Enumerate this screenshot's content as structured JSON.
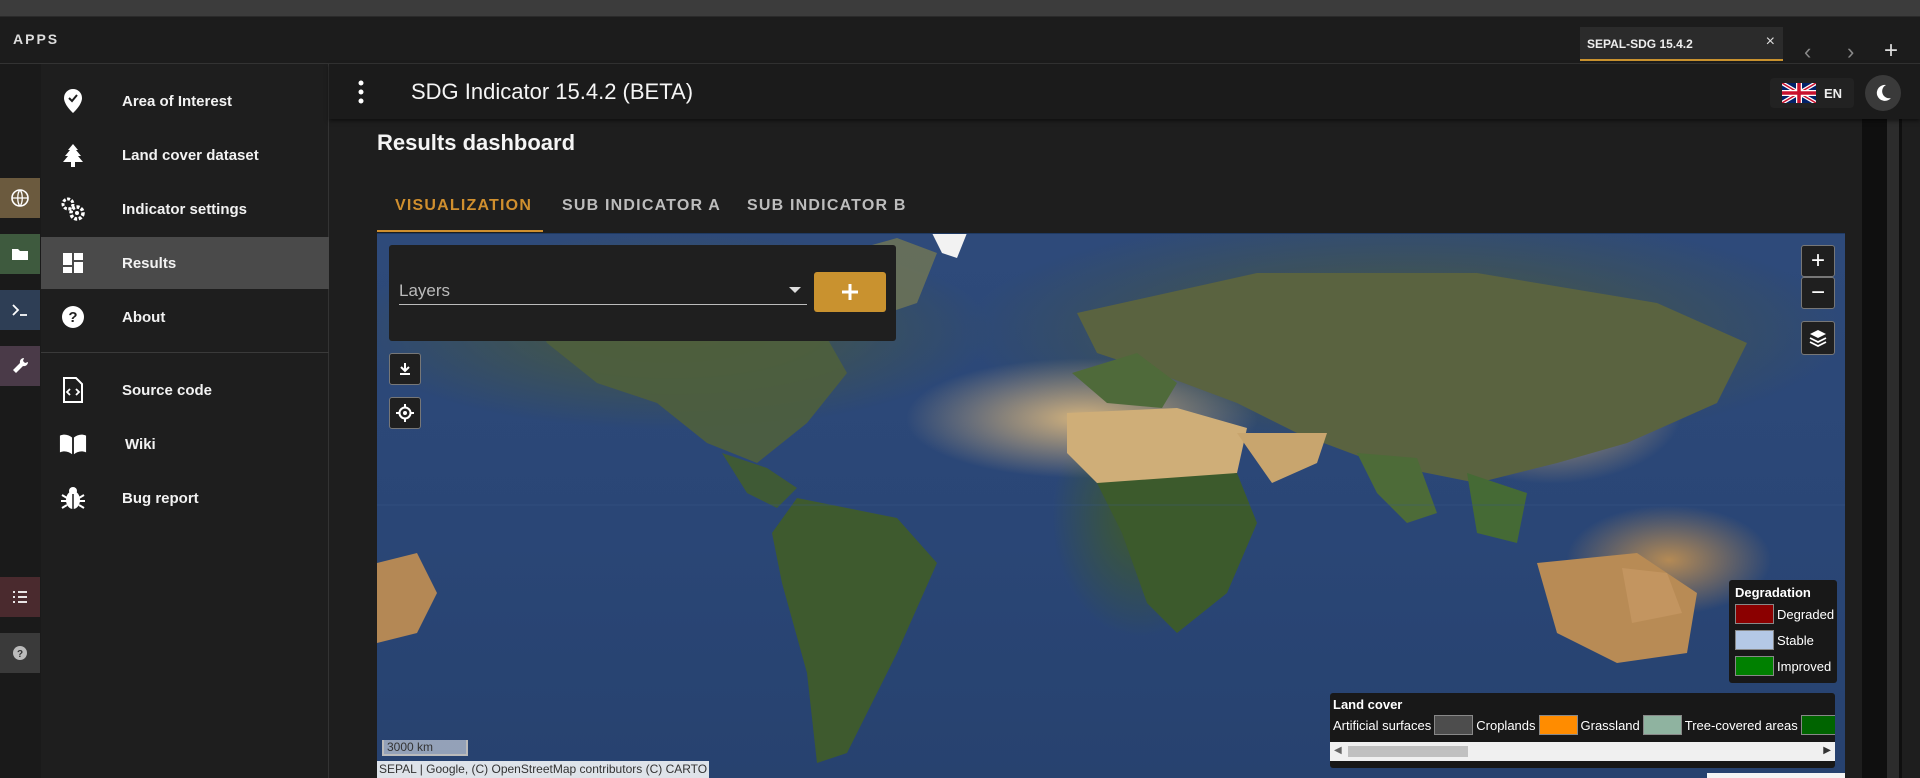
{
  "apps_bar": {
    "label": "APPS"
  },
  "browser_tab": {
    "label": "SEPAL-SDG 15.4.2",
    "close": "×",
    "prev": "‹",
    "next": "›",
    "add": "+"
  },
  "app_bar": {
    "title": "SDG Indicator 15.4.2 (BETA)",
    "language": "EN"
  },
  "drawer": {
    "items": [
      {
        "label": "Area of Interest",
        "icon": "map-marker-check-icon"
      },
      {
        "label": "Land cover dataset",
        "icon": "tree-icon"
      },
      {
        "label": "Indicator settings",
        "icon": "cogs-icon"
      },
      {
        "label": "Results",
        "icon": "dashboard-icon",
        "active": true
      },
      {
        "label": "About",
        "icon": "help-circle-icon"
      },
      {
        "label": "Source code",
        "icon": "file-code-icon"
      },
      {
        "label": "Wiki",
        "icon": "book-open-icon"
      },
      {
        "label": "Bug report",
        "icon": "bug-icon"
      }
    ]
  },
  "content": {
    "title": "Results dashboard",
    "tabs": [
      {
        "label": "VISUALIZATION",
        "active": true
      },
      {
        "label": "SUB INDICATOR A"
      },
      {
        "label": "SUB INDICATOR B"
      }
    ]
  },
  "map": {
    "layers_placeholder": "Layers",
    "add_label": "+",
    "zoom_in": "+",
    "zoom_out": "−",
    "scale": "3000 km",
    "attribution": "SEPAL | Google, (C) OpenStreetMap contributors (C) CARTO",
    "legend_degradation": {
      "title": "Degradation",
      "items": [
        {
          "label": "Degraded",
          "color": "#8b0000"
        },
        {
          "label": "Stable",
          "color": "#b4c8e6"
        },
        {
          "label": "Improved",
          "color": "#008000"
        }
      ]
    },
    "legend_land_cover": {
      "title": "Land cover",
      "items": [
        {
          "label": "Artificial surfaces",
          "color": "#4d4d4d"
        },
        {
          "label": "Croplands",
          "color": "#ff8c00"
        },
        {
          "label": "Grassland",
          "color": "#8fb3a0"
        },
        {
          "label": "Tree-covered areas",
          "color": "#006400"
        }
      ]
    }
  },
  "colors": {
    "accent": "#c9922f",
    "tab_active": "#d08f2e",
    "panel": "#1e1e1e"
  }
}
